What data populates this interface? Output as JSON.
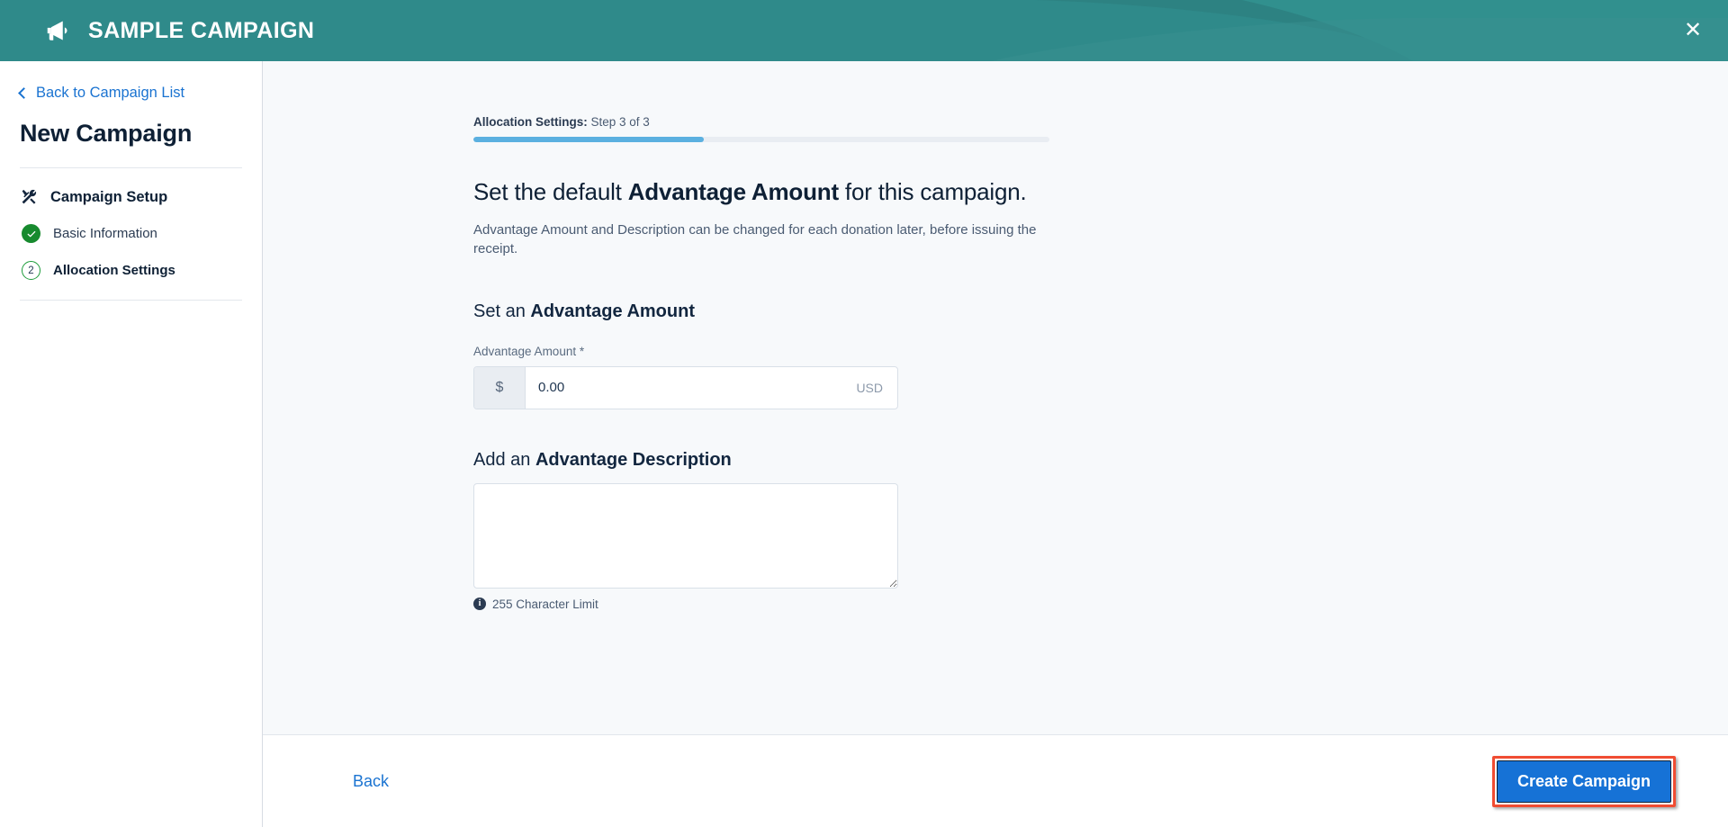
{
  "header": {
    "title": "SAMPLE CAMPAIGN",
    "brand_icon": "megaphone-icon",
    "close_label": "✕",
    "background_color": "#2f8a8a"
  },
  "sidebar": {
    "back_link": "Back to Campaign List",
    "page_title": "New Campaign",
    "group": {
      "icon": "tools-icon",
      "label": "Campaign Setup"
    },
    "items": [
      {
        "label": "Basic Information",
        "state": "done",
        "badge": "✓"
      },
      {
        "label": "Allocation Settings",
        "state": "current",
        "badge": "2"
      }
    ]
  },
  "main": {
    "progress": {
      "step_name": "Allocation Settings:",
      "step_text": " Step 3 of 3",
      "percent": 40,
      "fill_color": "#5bb0e0"
    },
    "lead_heading": {
      "before": "Set the default ",
      "emphasis": "Advantage Amount",
      "after": " for this campaign."
    },
    "lead_sub": "Advantage Amount and Description can be changed for each donation later, before issuing the receipt.",
    "amount_section": {
      "heading_before": "Set an ",
      "heading_emphasis": "Advantage Amount",
      "field_label": "Advantage Amount *",
      "currency_prefix": "$",
      "value": "0.00",
      "placeholder": "0.00",
      "currency_suffix": "USD"
    },
    "description_section": {
      "heading_before": "Add an ",
      "heading_emphasis": "Advantage Description",
      "value": "",
      "placeholder": "",
      "limit_note": "255 Character Limit",
      "limit_icon": "info-icon"
    }
  },
  "footer": {
    "back_label": "Back",
    "create_label": "Create Campaign",
    "create_color": "#1672d6",
    "highlight_color": "#f04c32"
  }
}
